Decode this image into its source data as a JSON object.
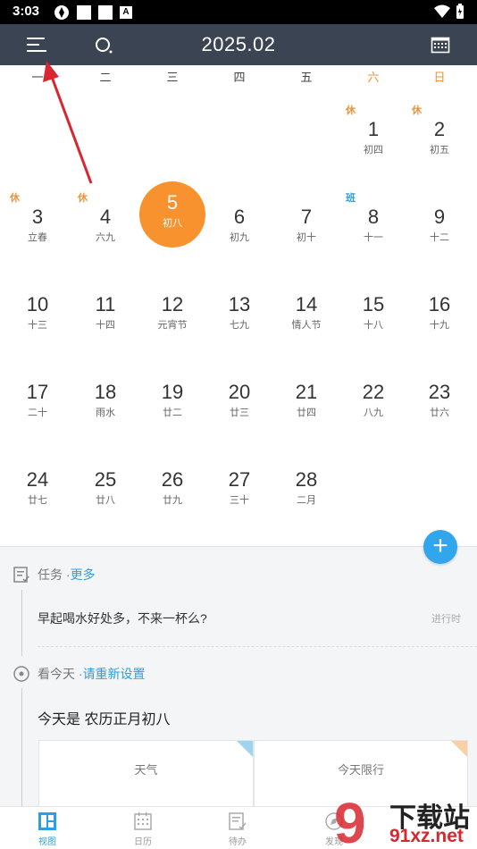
{
  "status_bar": {
    "time": "3:03",
    "a_badge": "A"
  },
  "toolbar": {
    "title": "2025.02"
  },
  "weekdays": [
    "一",
    "二",
    "三",
    "四",
    "五",
    "六",
    "日"
  ],
  "days": [
    {
      "num": "1",
      "lunar": "初四",
      "tag": "休"
    },
    {
      "num": "2",
      "lunar": "初五",
      "tag": "休"
    },
    {
      "num": "3",
      "lunar": "立春",
      "tag": "休"
    },
    {
      "num": "4",
      "lunar": "六九",
      "tag": "休"
    },
    {
      "num": "5",
      "lunar": "初八",
      "tag": ""
    },
    {
      "num": "6",
      "lunar": "初九",
      "tag": ""
    },
    {
      "num": "7",
      "lunar": "初十",
      "tag": ""
    },
    {
      "num": "8",
      "lunar": "十一",
      "tag": "班"
    },
    {
      "num": "9",
      "lunar": "十二",
      "tag": ""
    },
    {
      "num": "10",
      "lunar": "十三",
      "tag": ""
    },
    {
      "num": "11",
      "lunar": "十四",
      "tag": ""
    },
    {
      "num": "12",
      "lunar": "元宵节",
      "tag": ""
    },
    {
      "num": "13",
      "lunar": "七九",
      "tag": ""
    },
    {
      "num": "14",
      "lunar": "情人节",
      "tag": ""
    },
    {
      "num": "15",
      "lunar": "十八",
      "tag": ""
    },
    {
      "num": "16",
      "lunar": "十九",
      "tag": ""
    },
    {
      "num": "17",
      "lunar": "二十",
      "tag": ""
    },
    {
      "num": "18",
      "lunar": "雨水",
      "tag": ""
    },
    {
      "num": "19",
      "lunar": "廿二",
      "tag": ""
    },
    {
      "num": "20",
      "lunar": "廿三",
      "tag": ""
    },
    {
      "num": "21",
      "lunar": "廿四",
      "tag": ""
    },
    {
      "num": "22",
      "lunar": "八九",
      "tag": ""
    },
    {
      "num": "23",
      "lunar": "廿六",
      "tag": ""
    },
    {
      "num": "24",
      "lunar": "廿七",
      "tag": ""
    },
    {
      "num": "25",
      "lunar": "廿八",
      "tag": ""
    },
    {
      "num": "26",
      "lunar": "廿九",
      "tag": ""
    },
    {
      "num": "27",
      "lunar": "三十",
      "tag": ""
    },
    {
      "num": "28",
      "lunar": "二月",
      "tag": ""
    }
  ],
  "first_weekday_index": 5,
  "today": "5",
  "fab": {
    "label": "+"
  },
  "task_section": {
    "title": "任务 · ",
    "more": "更多",
    "item_text": "早起喝水好处多，不来一杯么?",
    "item_status": "进行时"
  },
  "today_section": {
    "title": "看今天 · ",
    "link": "请重新设置",
    "summary": "今天是 农历正月初八"
  },
  "cards": [
    {
      "label": "天气"
    },
    {
      "label": "今天限行"
    }
  ],
  "bottom_nav": [
    {
      "label": "视图",
      "icon": "view-icon",
      "active": true
    },
    {
      "label": "日历",
      "icon": "calendar-icon",
      "active": false
    },
    {
      "label": "待办",
      "icon": "todo-icon",
      "active": false
    },
    {
      "label": "发现",
      "icon": "discover-icon",
      "active": false
    }
  ],
  "watermark": {
    "text": "下载站",
    "url": "91xz.net"
  },
  "colors": {
    "accent": "#31a6ec",
    "today": "#f7922e",
    "toolbar": "#3a4452",
    "holiday": "#f0913b",
    "workday": "#2d9ee0"
  }
}
